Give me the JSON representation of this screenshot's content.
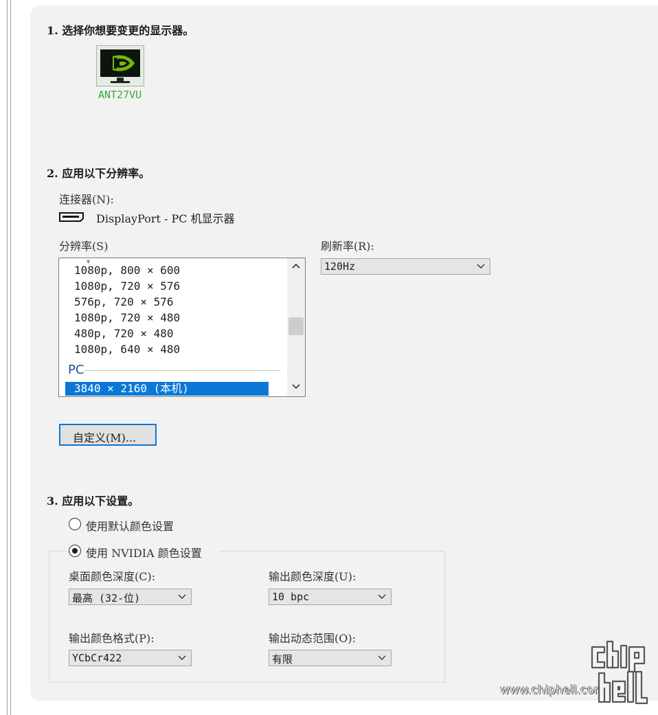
{
  "step1": {
    "title": "1. 选择你想要变更的显示器。",
    "monitor_name": "ANT27VU"
  },
  "step2": {
    "title": "2. 应用以下分辨率。",
    "connector_label": "连接器(N):",
    "connector_value": "DisplayPort - PC 机显示器",
    "resolution_label": "分辨率(S)",
    "refresh_label": "刷新率(R):",
    "refresh_value": "120Hz",
    "resolutions": [
      "1080p, 800 × 600",
      "1080p, 720 × 576",
      "576p, 720 × 576",
      "1080p, 720 × 480",
      "480p, 720 × 480",
      "1080p, 640 × 480"
    ],
    "group_pc": "PC",
    "selected_resolution": "3840 × 2160 (本机)",
    "custom_button": "自定义(M)..."
  },
  "step3": {
    "title": "3. 应用以下设置。",
    "radio_default": "使用默认颜色设置",
    "radio_nvidia": "使用 NVIDIA 颜色设置",
    "selected_radio": "nvidia",
    "desktop_depth_label": "桌面颜色深度(C):",
    "desktop_depth_value": "最高 (32-位)",
    "output_depth_label": "输出颜色深度(U):",
    "output_depth_value": "10 bpc",
    "output_format_label": "输出颜色格式(P):",
    "output_format_value": "YCbCr422",
    "dynamic_range_label": "输出动态范围(O):",
    "dynamic_range_value": "有限"
  },
  "watermark": {
    "site": "www.chiphell.com",
    "logo_text": "chip hell"
  },
  "colors": {
    "accent": "#0a78d7",
    "monitor_green": "#3aa83a",
    "panel_bg": "#f2f2f2"
  }
}
